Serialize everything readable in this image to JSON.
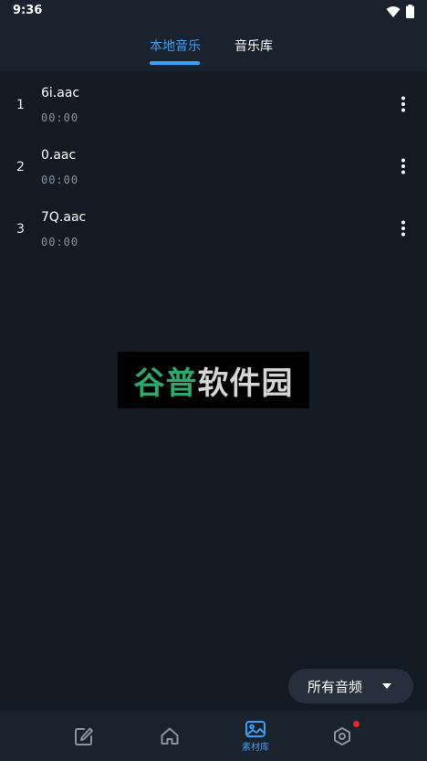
{
  "status_bar": {
    "time": "9:36"
  },
  "tabs": [
    {
      "label": "本地音乐",
      "active": true
    },
    {
      "label": "音乐库",
      "active": false
    }
  ],
  "tracks": [
    {
      "index": "1",
      "name": "6i.aac",
      "duration": "00:00"
    },
    {
      "index": "2",
      "name": "0.aac",
      "duration": "00:00"
    },
    {
      "index": "3",
      "name": "7Q.aac",
      "duration": "00:00"
    }
  ],
  "watermark": {
    "part1": "谷普",
    "part2": "软件园"
  },
  "filter": {
    "label": "所有音频"
  },
  "bottom_nav": {
    "items": [
      {
        "icon": "edit-icon"
      },
      {
        "icon": "home-icon"
      },
      {
        "icon": "image-library-icon",
        "label": "素材库",
        "active": true
      },
      {
        "icon": "hexagon-settings-icon",
        "badge": true
      }
    ]
  },
  "colors": {
    "accent": "#3d9df0",
    "background": "#131a24",
    "badge": "#e8262e"
  }
}
